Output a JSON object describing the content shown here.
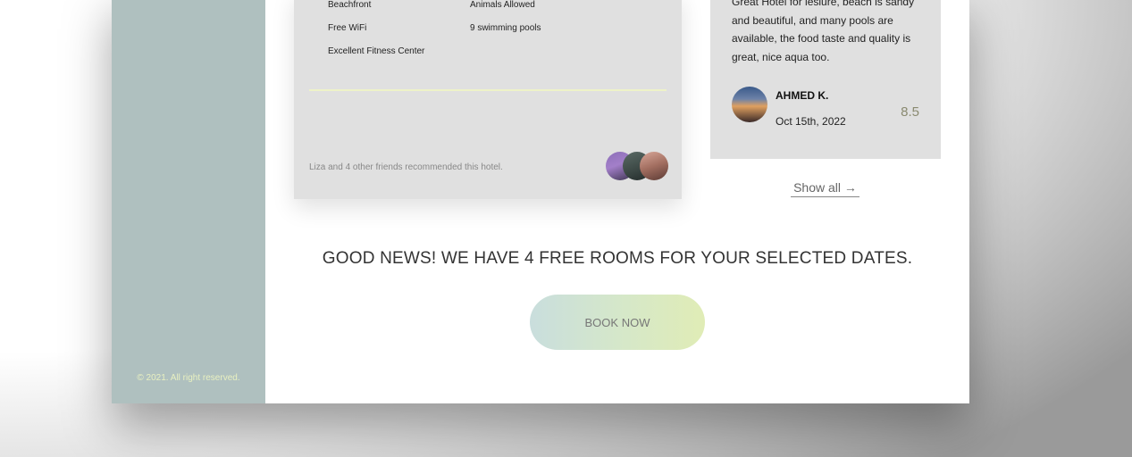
{
  "sidebar": {
    "copyright": "© 2021. All right reserved."
  },
  "hotel_card": {
    "amenities_left": [
      "Beachfront",
      "Free WiFi",
      "Excellent Fitness Center"
    ],
    "amenities_right": [
      "Animals Allowed",
      "9 swimming pools"
    ],
    "friends_text": "Liza and 4 other friends recommended this hotel."
  },
  "review": {
    "text": "Great Hotel for lesiure, beach is sandy and beautiful, and many pools are available, the food taste and quality is great, nice aqua too.",
    "reviewer_name": "AHMED K.",
    "date": "Oct 15th, 2022",
    "score": "8.5"
  },
  "show_all": "Show all →",
  "news": "GOOD NEWS! WE HAVE 4 FREE ROOMS FOR YOUR SELECTED DATES.",
  "book_button": "BOOK NOW"
}
